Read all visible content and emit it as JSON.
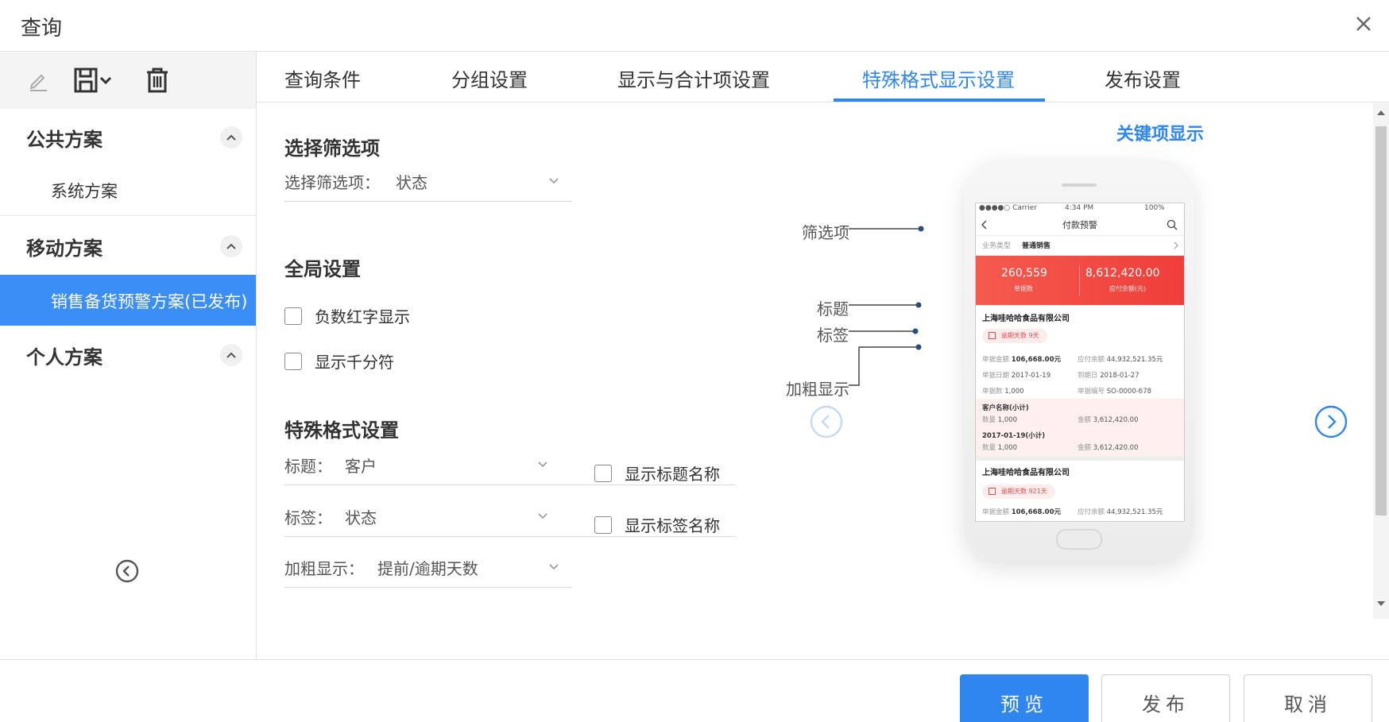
{
  "dialog": {
    "title": "查询"
  },
  "sidebar": {
    "groups": [
      {
        "label": "公共方案",
        "items": [
          {
            "label": "系统方案"
          }
        ]
      },
      {
        "label": "移动方案",
        "items": [
          {
            "label": "销售备货预警方案(已发布)"
          }
        ]
      },
      {
        "label": "个人方案",
        "items": []
      }
    ]
  },
  "tabs": [
    {
      "label": "查询条件"
    },
    {
      "label": "分组设置"
    },
    {
      "label": "显示与合计项设置"
    },
    {
      "label": "特殊格式显示设置"
    },
    {
      "label": "发布设置"
    }
  ],
  "filter_section": {
    "title": "选择筛选项",
    "field_label": "选择筛选项：",
    "field_value": "状态"
  },
  "global_section": {
    "title": "全局设置",
    "checkbox_negative_red": "负数红字显示",
    "checkbox_thousand_sep": "显示千分符"
  },
  "special_section": {
    "title": "特殊格式设置",
    "title_label": "标题：",
    "title_value": "客户",
    "title_checkbox": "显示标题名称",
    "tag_label": "标签：",
    "tag_value": "状态",
    "tag_checkbox": "显示标签名称",
    "bold_label": "加粗显示：",
    "bold_value": "提前/逾期天数"
  },
  "preview": {
    "title": "关键项显示",
    "callouts": {
      "filter": "筛选项",
      "title": "标题",
      "tag": "标签",
      "bold": "加粗显示"
    },
    "phone": {
      "status_carrier": "●●●●○ Carrier",
      "status_time": "4:34 PM",
      "status_battery": "100%",
      "nav_title": "付款预警",
      "filter_key": "业务类型",
      "filter_value": "普通销售",
      "stat1_value": "260,559",
      "stat1_label": "单据数",
      "stat2_value": "8,612,420.00",
      "stat2_label": "应付余额(元)",
      "card1_title": "上海哇哈哈食品有限公司",
      "card1_tag": "逾期天数 9天",
      "row1_k1": "单据金额",
      "row1_v1": "106,668.00元",
      "row1_k2": "应付余额",
      "row1_v2": "44,932,521.35元",
      "row2_k1": "单据日期",
      "row2_v1": "2017-01-19",
      "row2_k2": "到期日",
      "row2_v2": "2018-01-27",
      "row3_k1": "单据数",
      "row3_v1": "1,000",
      "row3_k2": "单据编号",
      "row3_v2": "SO-0000-678",
      "sub1_title": "客户名称(小计)",
      "sub1_k1": "数量",
      "sub1_v1": "1,000",
      "sub1_k2": "金额",
      "sub1_v2": "3,612,420.00",
      "sub2_title": "2017-01-19(小计)",
      "sub2_k1": "数量",
      "sub2_v1": "1,000",
      "sub2_k2": "金额",
      "sub2_v2": "3,612,420.00",
      "card2_title": "上海哇哈哈食品有限公司",
      "card2_tag": "逾期天数 921天",
      "row4_k1": "单据金额",
      "row4_v1": "106,668.00元",
      "row4_k2": "应付余额",
      "row4_v2": "44,932,521.35元"
    }
  },
  "footer": {
    "preview_label": "预览",
    "publish_label": "发布",
    "cancel_label": "取消"
  },
  "colors": {
    "accent": "#2f86ee",
    "danger": "#ef3e3a"
  }
}
